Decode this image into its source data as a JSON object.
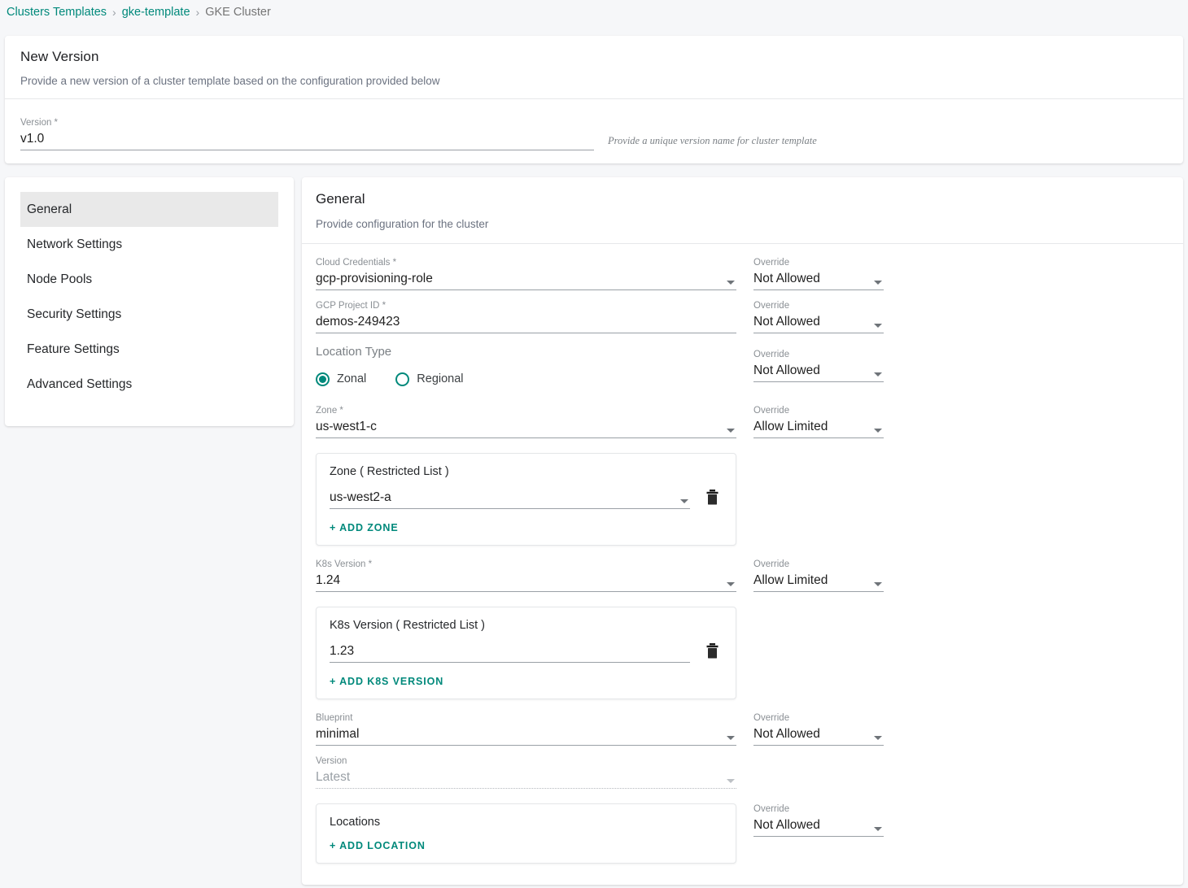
{
  "breadcrumb": {
    "items": [
      {
        "label": "Clusters Templates",
        "type": "link"
      },
      {
        "label": "gke-template",
        "type": "link"
      },
      {
        "label": "GKE Cluster",
        "type": "current"
      }
    ],
    "separator": "›"
  },
  "colors": {
    "accent": "#00897b",
    "page_bg": "#f6f7f9",
    "active_nav_bg": "#e9e9e9"
  },
  "new_version_card": {
    "title": "New Version",
    "subtitle": "Provide a new version of a cluster template based on the configuration provided below",
    "version_field": {
      "label": "Version *",
      "value": "v1.0"
    },
    "helper_text": "Provide a unique version name for cluster template"
  },
  "sidebar": {
    "items": [
      {
        "label": "General",
        "active": true
      },
      {
        "label": "Network Settings",
        "active": false
      },
      {
        "label": "Node Pools",
        "active": false
      },
      {
        "label": "Security Settings",
        "active": false
      },
      {
        "label": "Feature Settings",
        "active": false
      },
      {
        "label": "Advanced Settings",
        "active": false
      }
    ]
  },
  "main": {
    "title": "General",
    "subtitle": "Provide configuration for the cluster",
    "fields": {
      "cloud_credentials": {
        "label": "Cloud Credentials *",
        "value": "gcp-provisioning-role"
      },
      "gcp_project_id": {
        "label": "GCP Project ID *",
        "value": "demos-249423"
      },
      "location_type": {
        "label": "Location Type",
        "options": [
          {
            "label": "Zonal",
            "selected": true
          },
          {
            "label": "Regional",
            "selected": false
          }
        ]
      },
      "zone": {
        "label": "Zone *",
        "value": "us-west1-c"
      },
      "k8s_version": {
        "label": "K8s Version *",
        "value": "1.24"
      },
      "blueprint": {
        "label": "Blueprint",
        "value": "minimal"
      },
      "blueprint_version": {
        "label": "Version",
        "value": "Latest",
        "disabled": true
      }
    },
    "zone_restricted": {
      "title": "Zone ( Restricted List )",
      "value": "us-west2-a",
      "add_label": "+ ADD  ZONE",
      "delete_label": "delete"
    },
    "k8s_restricted": {
      "title": "K8s Version ( Restricted List )",
      "value": "1.23",
      "add_label": "+ ADD  K8S VERSION",
      "delete_label": "delete"
    },
    "locations": {
      "title": "Locations",
      "add_label": "+ ADD  LOCATION"
    },
    "overrides": {
      "label": "Override",
      "cloud_credentials": "Not Allowed",
      "gcp_project_id": "Not Allowed",
      "location_type": "Not Allowed",
      "zone": "Allow Limited",
      "k8s_version": "Allow Limited",
      "blueprint": "Not Allowed",
      "locations": "Not Allowed"
    }
  }
}
